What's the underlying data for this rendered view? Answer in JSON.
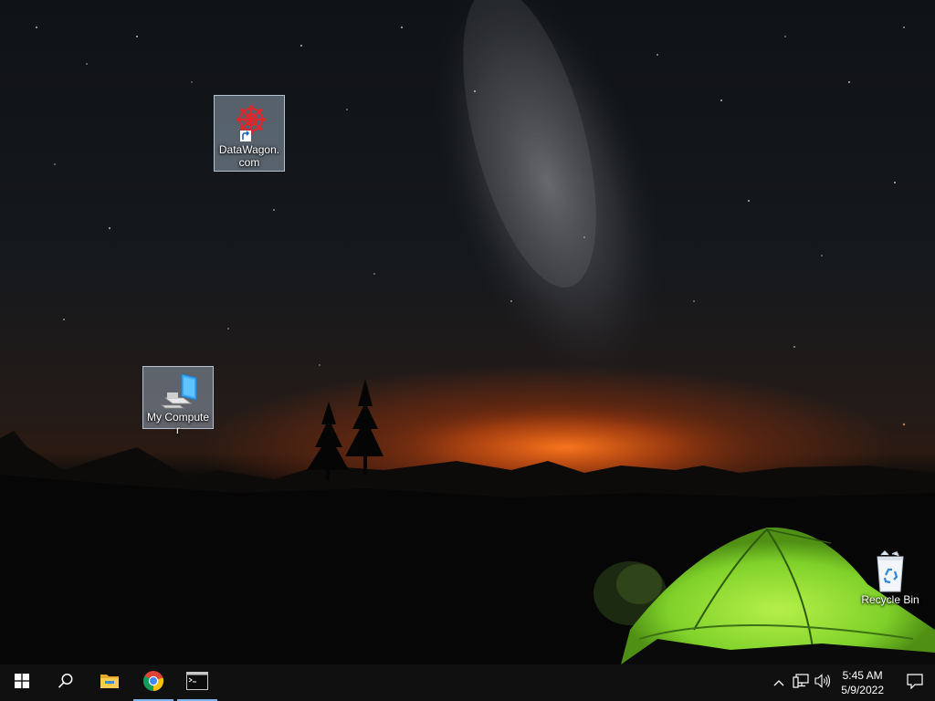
{
  "desktop": {
    "icons": [
      {
        "label": "DataWagon.com",
        "icon": "datawagon-shortcut-icon",
        "selected": true
      },
      {
        "label": "My Computer",
        "icon": "computer-icon",
        "selected": true
      },
      {
        "label": "Recycle Bin",
        "icon": "recycle-bin-icon",
        "selected": false
      }
    ]
  },
  "taskbar": {
    "buttons": [
      {
        "icon": "windows-start-icon"
      },
      {
        "icon": "search-icon"
      },
      {
        "icon": "file-explorer-icon"
      },
      {
        "icon": "chrome-icon",
        "active": true
      },
      {
        "icon": "command-prompt-icon",
        "active": true
      }
    ],
    "tray": {
      "icons": [
        "chevron-up-icon",
        "network-icon",
        "volume-icon"
      ],
      "time": "5:45 AM",
      "date": "5/9/2022",
      "notification_icon": "action-center-icon"
    }
  },
  "colors": {
    "taskbar_bg": "#101010",
    "accent": "#7eb4ea",
    "tent": "#7fd12a"
  }
}
